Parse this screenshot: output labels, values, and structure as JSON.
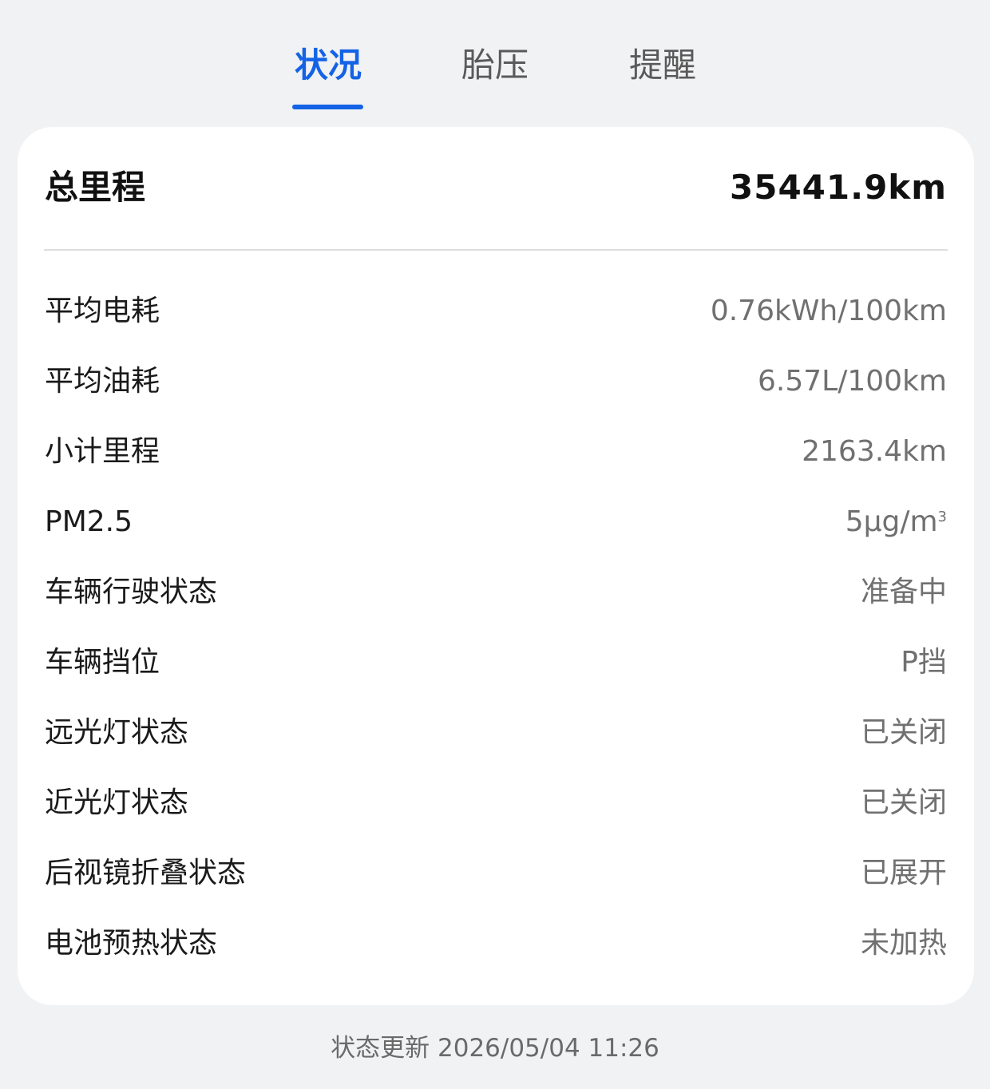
{
  "tabs": [
    {
      "label": "状况",
      "active": true
    },
    {
      "label": "胎压",
      "active": false
    },
    {
      "label": "提醒",
      "active": false
    }
  ],
  "summary": {
    "label": "总里程",
    "value": "35441.9km"
  },
  "rows": [
    {
      "label": "平均电耗",
      "value": "0.76kWh/100km"
    },
    {
      "label": "平均油耗",
      "value": "6.57L/100km"
    },
    {
      "label": "小计里程",
      "value": "2163.4km"
    },
    {
      "label": "PM2.5",
      "value": "5μg/m",
      "sup": "3"
    },
    {
      "label": "车辆行驶状态",
      "value": "准备中"
    },
    {
      "label": "车辆挡位",
      "value": "P挡"
    },
    {
      "label": "远光灯状态",
      "value": "已关闭"
    },
    {
      "label": "近光灯状态",
      "value": "已关闭"
    },
    {
      "label": "后视镜折叠状态",
      "value": "已展开"
    },
    {
      "label": "电池预热状态",
      "value": "未加热"
    }
  ],
  "footer": {
    "status_update": "状态更新 2026/05/04 11:26"
  },
  "colors": {
    "accent": "#1463e6",
    "background": "#f1f2f4",
    "card": "#ffffff"
  }
}
